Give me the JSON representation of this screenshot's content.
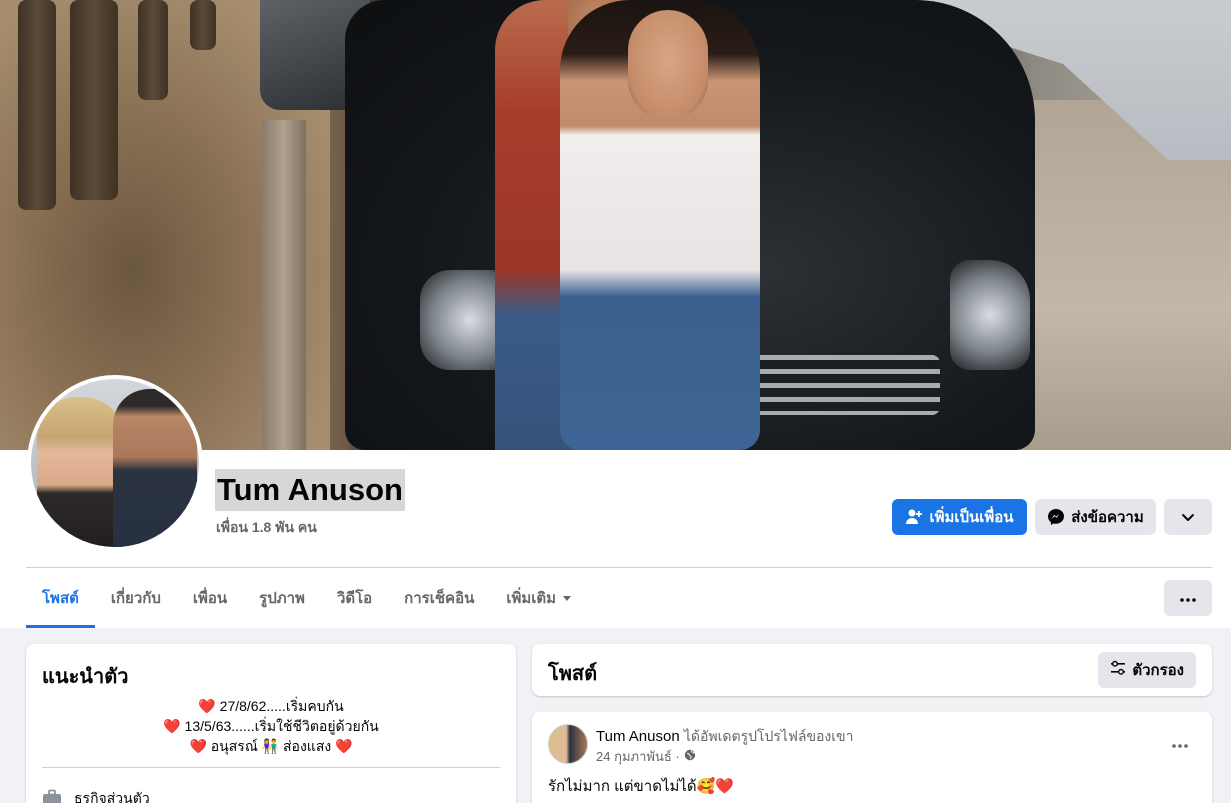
{
  "profile": {
    "name": "Tum Anuson",
    "friends_count": "เพื่อน 1.8 พัน คน"
  },
  "actions": {
    "add_friend": "เพิ่มเป็นเพื่อน",
    "message": "ส่งข้อความ"
  },
  "tabs": [
    {
      "label": "โพสต์",
      "active": true
    },
    {
      "label": "เกี่ยวกับ",
      "active": false
    },
    {
      "label": "เพื่อน",
      "active": false
    },
    {
      "label": "รูปภาพ",
      "active": false
    },
    {
      "label": "วิดีโอ",
      "active": false
    },
    {
      "label": "การเช็คอิน",
      "active": false
    },
    {
      "label": "เพิ่มเติม",
      "active": false
    }
  ],
  "intro": {
    "title": "แนะนำตัว",
    "bio_lines": [
      "❤️ 27/8/62.....เริ่มคบกัน",
      "❤️ 13/5/63......เริ่มใช้ชีวิตอยู่ด้วยกัน",
      "❤️ อนุสรณ์ 👫 ส่องแสง ❤️"
    ],
    "work": "ธุรกิจส่วนตัว"
  },
  "posts_section": {
    "title": "โพสต์",
    "filter_label": "ตัวกรอง"
  },
  "post": {
    "author": "Tum Anuson",
    "action": "ได้อัพเดตรูปโปรไฟล์ของเขา",
    "date": "24 กุมภาพันธ์ ·",
    "text": "รักไม่มาก แต่ขาดไม่ได้🥰❤️"
  },
  "colors": {
    "accent": "#1b74e4",
    "secondary_button": "#e4e6eb",
    "background": "#f0f2f5"
  }
}
